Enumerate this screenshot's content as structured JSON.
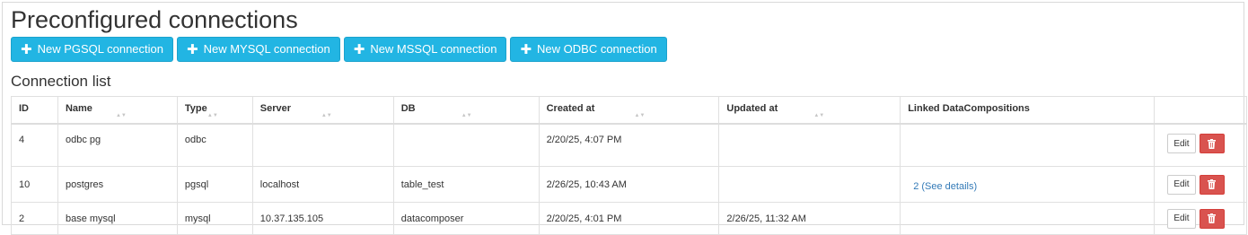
{
  "page": {
    "title": "Preconfigured connections"
  },
  "toolbar": {
    "buttons": [
      {
        "label": "New PGSQL connection",
        "icon": "plus-icon"
      },
      {
        "label": "New MYSQL connection",
        "icon": "plus-icon"
      },
      {
        "label": "New MSSQL connection",
        "icon": "plus-icon"
      },
      {
        "label": "New ODBC connection",
        "icon": "plus-icon"
      }
    ]
  },
  "connection_list": {
    "title": "Connection list",
    "columns": [
      "ID",
      "Name",
      "Type",
      "Server",
      "DB",
      "Created at",
      "Updated at",
      "Linked DataCompositions",
      ""
    ],
    "sortable": [
      false,
      true,
      true,
      true,
      true,
      true,
      true,
      false,
      false
    ],
    "rows": [
      {
        "id": "4",
        "name": "odbc pg",
        "type": "odbc",
        "server": "",
        "db": "",
        "created_at": "2/20/25, 4:07 PM",
        "updated_at": "",
        "linked": ""
      },
      {
        "id": "10",
        "name": "postgres",
        "type": "pgsql",
        "server": "localhost",
        "db": "table_test",
        "created_at": "2/26/25, 10:43 AM",
        "updated_at": "",
        "linked": "2 (See details)"
      },
      {
        "id": "2",
        "name": "base mysql",
        "type": "mysql",
        "server": "10.37.135.105",
        "db": "datacomposer",
        "created_at": "2/20/25, 4:01 PM",
        "updated_at": "2/26/25, 11:32 AM",
        "linked": ""
      }
    ],
    "row_actions": {
      "edit_label": "Edit",
      "delete_icon": "trash-icon"
    }
  },
  "colors": {
    "primary": "#22b5e3",
    "danger": "#d9534f",
    "link": "#337ab7"
  }
}
